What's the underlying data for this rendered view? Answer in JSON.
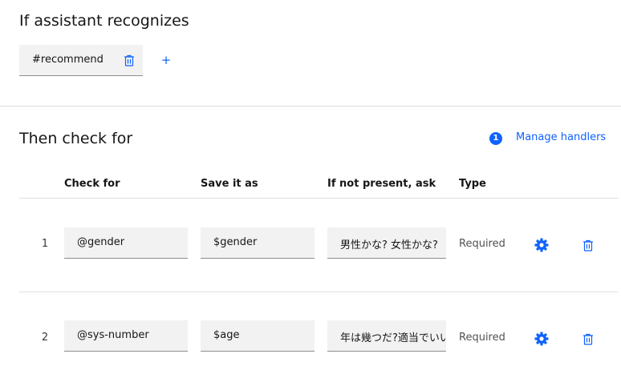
{
  "condition": {
    "title": "If assistant recognizes",
    "tag_text": "#recommend",
    "add_label": "+"
  },
  "checks": {
    "title": "Then check for",
    "handler_count": "1",
    "manage_label": "Manage handlers",
    "headers": {
      "check_for": "Check for",
      "save_as": "Save it as",
      "ask": "If not present, ask",
      "type": "Type"
    },
    "rows": [
      {
        "num": "1",
        "check_for": "@gender",
        "save_as": "$gender",
        "ask": "男性かな? 女性かな?",
        "type": "Required"
      },
      {
        "num": "2",
        "check_for": "@sys-number",
        "save_as": "$age",
        "ask": "年は幾つだ?適当でいいよ",
        "type": "Required"
      }
    ]
  },
  "icons": {
    "trash": "trash-icon",
    "settings": "gear-icon",
    "add": "plus-icon"
  },
  "colors": {
    "accent": "#0f62fe",
    "field_bg": "#f2f2f2",
    "text_primary": "#161616",
    "text_secondary": "#525252"
  }
}
